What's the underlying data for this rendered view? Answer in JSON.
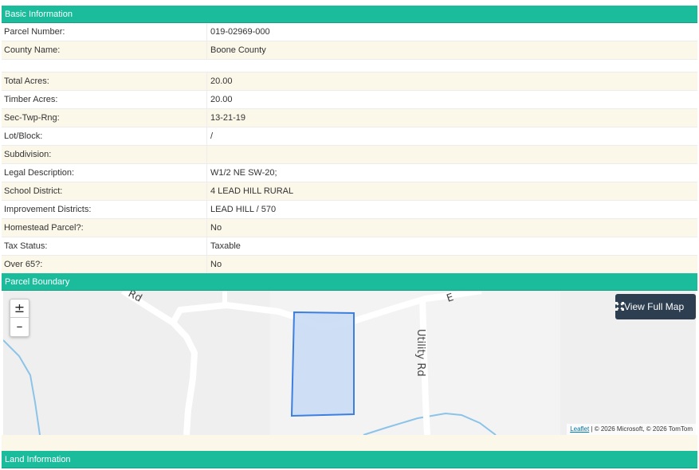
{
  "basic": {
    "header": "Basic Information",
    "rows": [
      {
        "label": "Parcel Number:",
        "value": "019-02969-000"
      },
      {
        "label": "County Name:",
        "value": "Boone County"
      },
      {
        "label": "Total Acres:",
        "value": "20.00"
      },
      {
        "label": "Timber Acres:",
        "value": "20.00"
      },
      {
        "label": "Sec-Twp-Rng:",
        "value": "13-21-19"
      },
      {
        "label": "Lot/Block:",
        "value": "/"
      },
      {
        "label": "Subdivision:",
        "value": ""
      },
      {
        "label": "Legal Description:",
        "value": "W1/2 NE SW-20;"
      },
      {
        "label": "School District:",
        "value": "4 LEAD HILL RURAL"
      },
      {
        "label": "Improvement Districts:",
        "value": "LEAD HILL / 570"
      },
      {
        "label": "Homestead Parcel?:",
        "value": "No"
      },
      {
        "label": "Tax Status:",
        "value": "Taxable"
      },
      {
        "label": "Over 65?:",
        "value": "No"
      }
    ]
  },
  "parcel_boundary": {
    "header": "Parcel Boundary",
    "zoom_in": "±",
    "zoom_out": "–",
    "view_full_map_label": "View Full Map",
    "full_map_icon": "expand-icon",
    "attribution_link": "Leaflet",
    "attribution_text": " | © 2026 Microsoft, © 2026 TomTom",
    "road_labels": {
      "road_a": "Rd",
      "road_b": "E",
      "utility": "Utility Rd"
    },
    "colors": {
      "parcel_fill": "#c7dbf5",
      "parcel_stroke": "#3d7fe0",
      "water": "#8cc3e8",
      "road": "#ffffff"
    }
  },
  "land": {
    "header": "Land Information"
  },
  "colors": {
    "header_bg": "#1abc9c",
    "row_alt": "#fbf7e9",
    "button_bg": "#2c3e50"
  }
}
